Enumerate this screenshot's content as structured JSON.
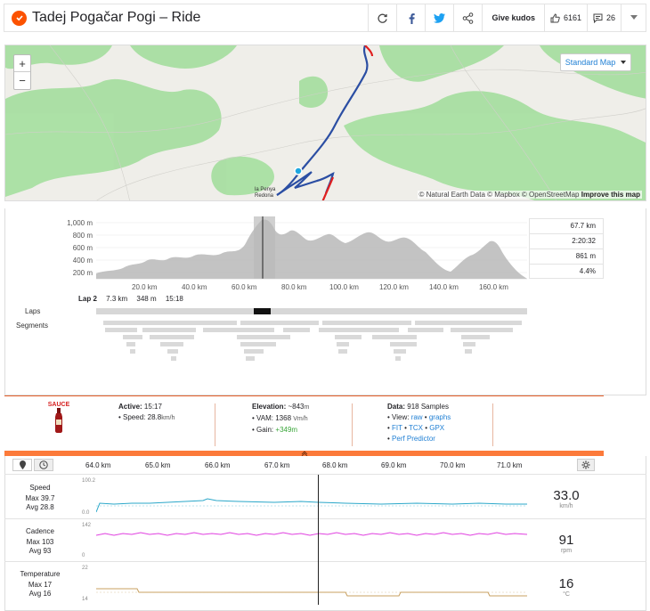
{
  "header": {
    "title": "Tadej Pogačar Pogi – Ride",
    "kudos_label": "Give kudos",
    "kudos_count": "6161",
    "comment_count": "26"
  },
  "map": {
    "zoom_in": "+",
    "zoom_out": "−",
    "map_type": "Standard Map",
    "attribution_text": "© Natural Earth Data © Mapbox © OpenStreetMap",
    "attribution_link": "Improve this map",
    "town_line1": "la Penya",
    "town_line2": "Redona"
  },
  "elevation": {
    "y_ticks": [
      "1,000 m",
      "800 m",
      "600 m",
      "400 m",
      "200 m"
    ],
    "x_ticks": [
      "20.0 km",
      "40.0 km",
      "60.0 km",
      "80.0 km",
      "100.0 km",
      "120.0 km",
      "140.0 km",
      "160.0 km"
    ],
    "stats": [
      "67.7 km",
      "2:20:32",
      "861 m",
      "4.4%"
    ]
  },
  "lap": {
    "name": "Lap 2",
    "distance": "7.3 km",
    "elevation": "348 m",
    "time": "15:18"
  },
  "rows": {
    "laps": "Laps",
    "segments": "Segments"
  },
  "sauce": {
    "logo": "SAUCE",
    "active_label": "Active:",
    "active_value": "15:17",
    "speed_label": "• Speed:",
    "speed_value": "28.8",
    "speed_unit": "km/h",
    "elev_label": "Elevation:",
    "elev_value": "~843",
    "elev_unit": "m",
    "vam_label": "• VAM:",
    "vam_value": "1368",
    "vam_unit": "Vm/h",
    "gain_label": "• Gain:",
    "gain_value": "+349m",
    "data_label": "Data:",
    "data_value": "918 Samples",
    "view_label": "• View:",
    "view_raw": "raw",
    "view_graphs": "graphs",
    "fit": "FIT",
    "tcx": "TCX",
    "gpx": "GPX",
    "perf": "Perf Predictor"
  },
  "detail": {
    "x_ticks": [
      "64.0 km",
      "65.0 km",
      "66.0 km",
      "67.0 km",
      "68.0 km",
      "69.0 km",
      "70.0 km",
      "71.0 km"
    ],
    "speed": {
      "name": "Speed",
      "max": "Max 39.7",
      "avg": "Avg 28.8",
      "ytop": "100.2",
      "ybot": "0.0",
      "value": "33.0",
      "unit": "km/h"
    },
    "cadence": {
      "name": "Cadence",
      "max": "Max 103",
      "avg": "Avg 93",
      "ytop": "142",
      "ybot": "0",
      "value": "91",
      "unit": "rpm"
    },
    "temperature": {
      "name": "Temperature",
      "max": "Max 17",
      "avg": "Avg 16",
      "ytop": "22",
      "ybot": "14",
      "value": "16",
      "unit": "°C"
    }
  },
  "colors": {
    "strava": "#fc5200",
    "speed": "#2aa7c9",
    "cadence": "#e040e0",
    "temp": "#c8a060",
    "route": "#2b4ea3"
  }
}
